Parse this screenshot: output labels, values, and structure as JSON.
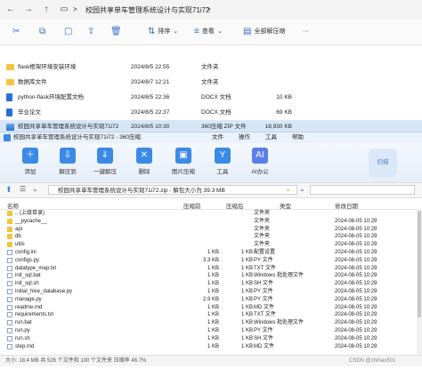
{
  "explorer": {
    "breadcrumb": [
      "校园共享单车管理系统设计与实现71i72"
    ],
    "breadcrumb_sep": ">",
    "toolbar": {
      "sort": "排序",
      "view": "查看",
      "extract_all": "全部解压缩",
      "more": "···"
    },
    "rows": [
      {
        "name": "flask框架环境安装环境",
        "date": "2024/8/5 22:55",
        "type": "文件夹",
        "size": "",
        "icon": "folder"
      },
      {
        "name": "数据库文件",
        "date": "2024/8/7 12:21",
        "type": "文件夹",
        "size": "",
        "icon": "folder"
      },
      {
        "name": "python-flask环境配置文档",
        "date": "2024/8/5 22:36",
        "type": "DOCX 文档",
        "size": "10 KB",
        "icon": "docx"
      },
      {
        "name": "毕业论文",
        "date": "2024/8/5 22:37",
        "type": "DOCX 文档",
        "size": "69 KB",
        "icon": "docx"
      },
      {
        "name": "校园共享单车管理系统设计与实现71i72",
        "date": "2024/8/5 10:30",
        "type": "360压缩 ZIP 文件",
        "size": "18,930 KB",
        "icon": "zip"
      }
    ]
  },
  "zipwin": {
    "title": "校园共享单车管理系统设计与实现71i72 - 360压缩",
    "menu": [
      "文件",
      "操作",
      "工具",
      "帮助"
    ],
    "tools": [
      {
        "label": "添加",
        "icon": "＋"
      },
      {
        "label": "解压到",
        "icon": "⇩"
      },
      {
        "label": "一键解压",
        "icon": "⇓"
      },
      {
        "label": "删除",
        "icon": "✕"
      },
      {
        "label": "图片压缩",
        "icon": "▣"
      },
      {
        "label": "工具",
        "icon": "Y"
      },
      {
        "label": "AI办公",
        "icon": "AI"
      }
    ],
    "scan_label": "扫描",
    "path": "校园共享单车管理系统设计与实现71i72.zip - 解包大小为 39.3 MB",
    "columns": {
      "name": "名称",
      "compressed": "压缩前",
      "compressed_after": "压缩后",
      "type": "类型",
      "modified": "修改日期"
    },
    "files": [
      {
        "name": ".. (上级目录)",
        "before": "",
        "after": "",
        "type": "文件夹",
        "date": "",
        "kind": "folder"
      },
      {
        "name": "__pycache__",
        "before": "",
        "after": "",
        "type": "文件夹",
        "date": "2024-08-05 10:29",
        "kind": "folder"
      },
      {
        "name": "api",
        "before": "",
        "after": "",
        "type": "文件夹",
        "date": "2024-08-05 10:29",
        "kind": "folder"
      },
      {
        "name": "db",
        "before": "",
        "after": "",
        "type": "文件夹",
        "date": "2024-08-05 10:29",
        "kind": "folder"
      },
      {
        "name": "utils",
        "before": "",
        "after": "",
        "type": "文件夹",
        "date": "2024-08-05 10:29",
        "kind": "folder"
      },
      {
        "name": "config.ini",
        "before": "1 KB",
        "after": "1 KB",
        "type": "配置设置",
        "date": "2024-08-05 10:29",
        "kind": "file"
      },
      {
        "name": "configs.py",
        "before": "3.3 KB",
        "after": "1 KB",
        "type": "PY 文件",
        "date": "2024-08-05 10:29",
        "kind": "file"
      },
      {
        "name": "datatype_map.txt",
        "before": "1 KB",
        "after": "1 KB",
        "type": "TXT 文件",
        "date": "2024-08-05 10:29",
        "kind": "file"
      },
      {
        "name": "init_sql.bat",
        "before": "1 KB",
        "after": "1 KB",
        "type": "Windows 批处理文件",
        "date": "2024-08-05 10:29",
        "kind": "file"
      },
      {
        "name": "init_sql.sh",
        "before": "1 KB",
        "after": "1 KB",
        "type": "SH 文件",
        "date": "2024-08-05 10:29",
        "kind": "file"
      },
      {
        "name": "initial_hive_database.py",
        "before": "1 KB",
        "after": "1 KB",
        "type": "PY 文件",
        "date": "2024-08-05 10:29",
        "kind": "file"
      },
      {
        "name": "manage.py",
        "before": "2.9 KB",
        "after": "1 KB",
        "type": "PY 文件",
        "date": "2024-08-05 10:29",
        "kind": "file"
      },
      {
        "name": "readme.md",
        "before": "1 KB",
        "after": "1 KB",
        "type": "MD 文件",
        "date": "2024-08-05 10:29",
        "kind": "file"
      },
      {
        "name": "requirements.txt",
        "before": "1 KB",
        "after": "1 KB",
        "type": "TXT 文件",
        "date": "2024-08-05 10:29",
        "kind": "file"
      },
      {
        "name": "run.bat",
        "before": "1 KB",
        "after": "1 KB",
        "type": "Windows 批处理文件",
        "date": "2024-08-05 10:29",
        "kind": "file"
      },
      {
        "name": "run.py",
        "before": "1 KB",
        "after": "1 KB",
        "type": "PY 文件",
        "date": "2024-08-05 10:29",
        "kind": "file"
      },
      {
        "name": "run.sh",
        "before": "1 KB",
        "after": "1 KB",
        "type": "SH 文件",
        "date": "2024-08-05 10:29",
        "kind": "file"
      },
      {
        "name": "step.md",
        "before": "1 KB",
        "after": "1 KB",
        "type": "MD 文件",
        "date": "2024-08-05 10:29",
        "kind": "file"
      }
    ],
    "status": "大小: 18.4 MB 共 526 个文件和 100 个文件夹 压缩率 46.7%",
    "watermark": "CSDN @zhihao501"
  }
}
